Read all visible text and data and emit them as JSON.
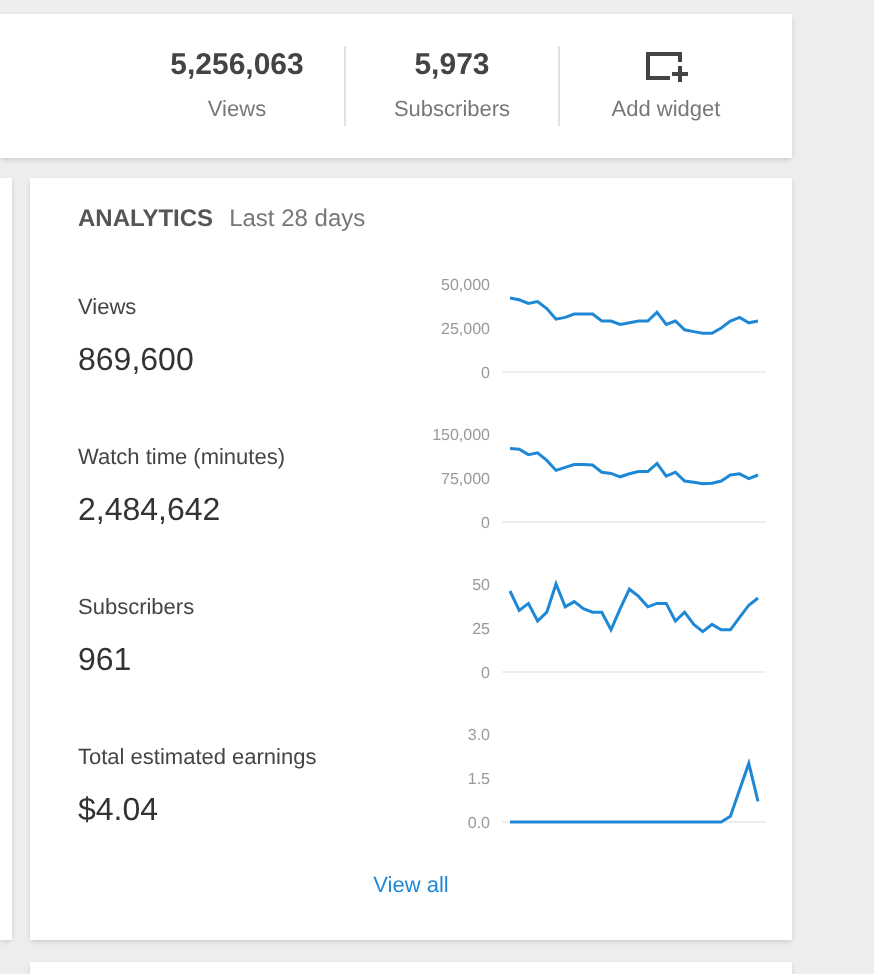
{
  "stats": [
    {
      "kind": "stat",
      "value": "5,256,063",
      "label": "Views"
    },
    {
      "kind": "stat",
      "value": "5,973",
      "label": "Subscribers"
    },
    {
      "kind": "action",
      "label": "Add widget"
    }
  ],
  "analytics": {
    "title": "ANALYTICS",
    "period": "Last 28 days",
    "metrics": [
      {
        "label": "Views",
        "value": "869,600",
        "chart_data": {
          "type": "line",
          "ylim": [
            0,
            50000
          ],
          "yticks": [
            {
              "value": 0,
              "label": "0"
            },
            {
              "value": 25000,
              "label": "25,000"
            },
            {
              "value": 50000,
              "label": "50,000"
            }
          ],
          "series": [
            {
              "color": "#1e88d6",
              "values": [
                42000,
                41000,
                39000,
                40000,
                36000,
                30000,
                31000,
                33000,
                33000,
                33000,
                29000,
                29000,
                27000,
                28000,
                29000,
                29000,
                34000,
                27000,
                29000,
                24000,
                23000,
                22000,
                22000,
                25000,
                29000,
                31000,
                28000,
                29000
              ]
            }
          ]
        }
      },
      {
        "label": "Watch time (minutes)",
        "value": "2,484,642",
        "chart_data": {
          "type": "line",
          "ylim": [
            0,
            150000
          ],
          "yticks": [
            {
              "value": 0,
              "label": "0"
            },
            {
              "value": 75000,
              "label": "75,000"
            },
            {
              "value": 150000,
              "label": "150,000"
            }
          ],
          "series": [
            {
              "color": "#1e88d6",
              "values": [
                125000,
                124000,
                115000,
                118000,
                105000,
                88000,
                93000,
                98000,
                98000,
                97000,
                85000,
                83000,
                77000,
                82000,
                86000,
                86000,
                100000,
                78000,
                85000,
                70000,
                68000,
                65000,
                66000,
                70000,
                80000,
                82000,
                74000,
                80000
              ]
            }
          ]
        }
      },
      {
        "label": "Subscribers",
        "value": "961",
        "chart_data": {
          "type": "line",
          "ylim": [
            0,
            50
          ],
          "yticks": [
            {
              "value": 0,
              "label": "0"
            },
            {
              "value": 25,
              "label": "25"
            },
            {
              "value": 50,
              "label": "50"
            }
          ],
          "series": [
            {
              "color": "#1e88d6",
              "values": [
                46,
                35,
                39,
                29,
                34,
                50,
                37,
                40,
                36,
                34,
                34,
                24,
                36,
                47,
                43,
                37,
                39,
                39,
                29,
                34,
                27,
                23,
                27,
                24,
                24,
                31,
                38,
                42
              ]
            }
          ]
        }
      },
      {
        "label": "Total estimated earnings",
        "value": "$4.04",
        "chart_data": {
          "type": "line",
          "ylim": [
            0,
            3
          ],
          "yticks": [
            {
              "value": 0,
              "label": "0.0"
            },
            {
              "value": 1.5,
              "label": "1.5"
            },
            {
              "value": 3,
              "label": "3.0"
            }
          ],
          "series": [
            {
              "color": "#1e88d6",
              "values": [
                0,
                0,
                0,
                0,
                0,
                0,
                0,
                0,
                0,
                0,
                0,
                0,
                0,
                0,
                0,
                0,
                0,
                0,
                0,
                0,
                0,
                0,
                0,
                0,
                0.2,
                1.1,
                2.0,
                0.7
              ]
            }
          ]
        }
      }
    ],
    "link": "View all"
  }
}
